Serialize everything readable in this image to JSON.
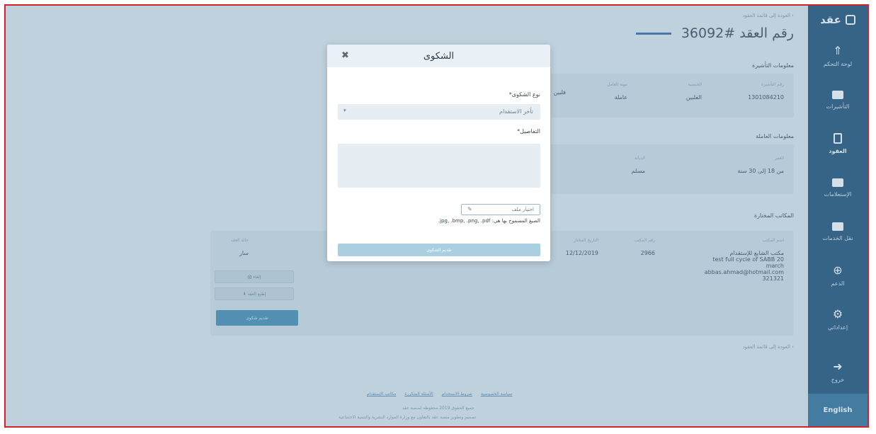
{
  "sidebar": {
    "logo_text": "عقد",
    "items": [
      {
        "label": "لوحة التحكم",
        "icon": "rocket-icon"
      },
      {
        "label": "التأشيرات",
        "icon": "card-icon"
      },
      {
        "label": "العقود",
        "icon": "document-icon"
      },
      {
        "label": "الإستعلامات",
        "icon": "card-icon"
      },
      {
        "label": "نقل الخدمات",
        "icon": "card-icon"
      },
      {
        "label": "الدعم",
        "icon": "globe-icon"
      },
      {
        "label": "إعداداتي",
        "icon": "gear-icon"
      },
      {
        "label": "خروج",
        "icon": "logout-icon"
      }
    ],
    "language_button": "English"
  },
  "main": {
    "breadcrumb": "‹ العودة إلى قائمة العقود",
    "contract_title": "رقم العقد #36092",
    "visa_section": {
      "heading": "معلومات التأشيرة",
      "fields": [
        {
          "label": "رقم التأشيرة",
          "value": "1301084210"
        },
        {
          "label": "الجنسية",
          "value": "الفلبين"
        },
        {
          "label": "مهنة العامل",
          "value": "عاملة"
        },
        {
          "label": "",
          "value": "فلبين"
        }
      ]
    },
    "worker_section": {
      "heading": "معلومات العاملة",
      "fields": [
        {
          "label": "العمر",
          "value": "من 18 إلى 30 سنة"
        },
        {
          "label": "الديانة",
          "value": "مسلم"
        }
      ]
    },
    "offices_section": {
      "heading": "المكاتب المختارة",
      "office_name_label": "اسم المكتب",
      "office_name_lines": [
        "مكتب الشايع للإستقدام",
        "test full cycle of SABB 20",
        "march",
        "abbas.ahmad@hotmail.com",
        "321321"
      ],
      "office_number_label": "رقم المكتب",
      "office_number": "2966",
      "date_label": "التاريخ المختار",
      "date_value": "12/12/2019",
      "status_label": "حالة العقد",
      "status_value": "سار",
      "cancel_button": "إلغاء ⨂",
      "print_button": "إطبع العقد ⬇",
      "complaint_button": "تقديم شكوى"
    },
    "back_link": "‹ العودة إلى قائمة العقود",
    "footer": {
      "links": [
        "سياسة الخصوصية",
        "شروط الاستخدام",
        "الأسئلة المتكررة",
        "مكاتب الإستقدام"
      ],
      "copyright": "جميع الحقوق 2019 محفوظة لمنصة عقد",
      "credit": "تصميم وتطوير منصة عقد بالتعاون مع وزارة الموارد البشرية والتنمية الاجتماعية"
    }
  },
  "modal": {
    "title": "الشكوى",
    "complaint_type_label": "نوع الشكوى*",
    "complaint_type_value": "تأخر الاستقدام",
    "details_label": "التفاصيل*",
    "details_value": "",
    "file_button": "اختيار ملف",
    "allowed_formats_note": "الصيغ المسموح بها هي: jpg, .bmp, .png, .pdf.",
    "submit_button": "تقديم الشكوى"
  },
  "colors": {
    "sidebar": "#174a70",
    "accent": "#3560a8",
    "submit_disabled": "#a9cfe0",
    "frame_border": "#d2232a"
  }
}
